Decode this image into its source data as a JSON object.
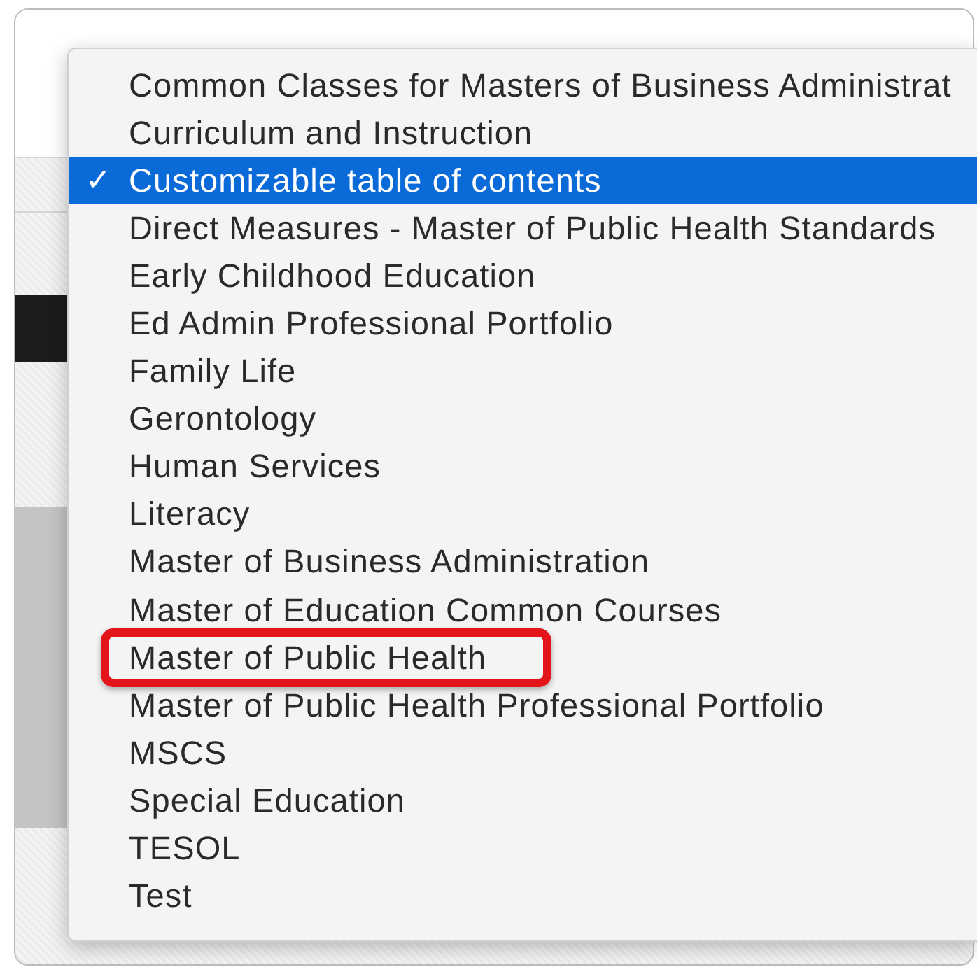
{
  "menu": {
    "check_mark": "✓",
    "items": [
      {
        "label": "Common Classes for Masters of Business Administrat",
        "selected": false,
        "circled": false
      },
      {
        "label": "Curriculum and Instruction",
        "selected": false,
        "circled": false
      },
      {
        "label": "Customizable table of contents",
        "selected": true,
        "circled": false
      },
      {
        "label": "Direct Measures - Master of Public Health Standards",
        "selected": false,
        "circled": false
      },
      {
        "label": "Early Childhood Education",
        "selected": false,
        "circled": false
      },
      {
        "label": "Ed Admin Professional Portfolio",
        "selected": false,
        "circled": false
      },
      {
        "label": "Family Life",
        "selected": false,
        "circled": false
      },
      {
        "label": "Gerontology",
        "selected": false,
        "circled": false
      },
      {
        "label": "Human Services",
        "selected": false,
        "circled": false
      },
      {
        "label": "Literacy",
        "selected": false,
        "circled": false
      },
      {
        "label": "Master of Business Administration",
        "selected": false,
        "circled": false
      },
      {
        "label": "Master of Education Common Courses",
        "selected": false,
        "circled": false
      },
      {
        "label": "Master of Public Health",
        "selected": false,
        "circled": true
      },
      {
        "label": "Master of Public Health Professional Portfolio",
        "selected": false,
        "circled": false
      },
      {
        "label": "MSCS",
        "selected": false,
        "circled": false
      },
      {
        "label": "Special Education",
        "selected": false,
        "circled": false
      },
      {
        "label": "TESOL",
        "selected": false,
        "circled": false
      },
      {
        "label": "Test",
        "selected": false,
        "circled": false
      }
    ]
  }
}
